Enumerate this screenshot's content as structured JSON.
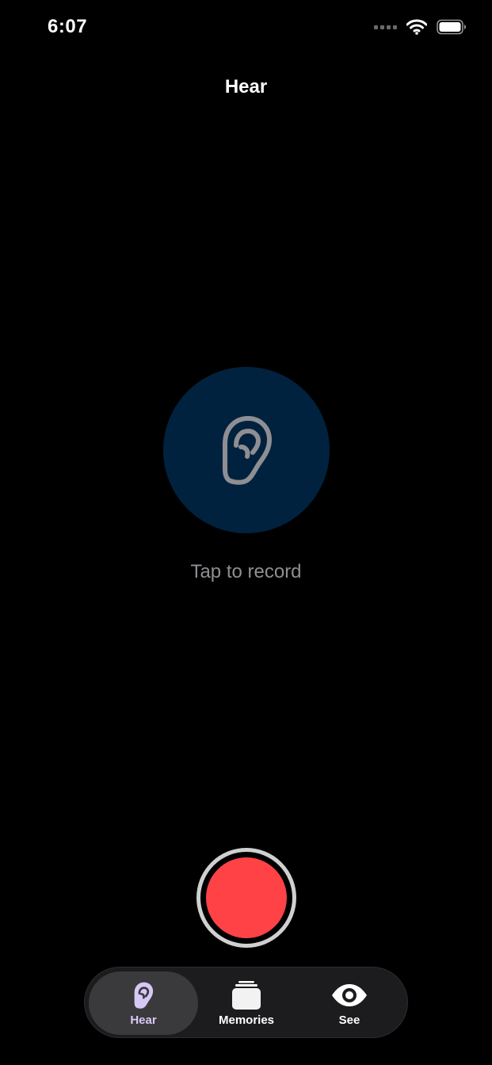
{
  "status_bar": {
    "time": "6:07",
    "signal_icon": "signal-dots-icon",
    "wifi_icon": "wifi-icon",
    "battery_icon": "battery-icon"
  },
  "nav": {
    "title": "Hear"
  },
  "main": {
    "hear_icon": "ear-icon",
    "hint": "Tap to record"
  },
  "record": {
    "icon": "record-dot"
  },
  "tabs": [
    {
      "label": "Hear",
      "icon": "ear-icon",
      "active": true
    },
    {
      "label": "Memories",
      "icon": "stack-icon",
      "active": false
    },
    {
      "label": "See",
      "icon": "eye-icon",
      "active": false
    }
  ],
  "colors": {
    "background": "#000000",
    "circle": "#00223f",
    "ear_stroke": "#8e8e93",
    "hint_text": "#8e8e93",
    "record_red": "#ff4245",
    "active_tab_tint": "#d8c8f6",
    "tab_bar": "#1c1c1e",
    "active_tab_bg": "#3a3a3c"
  }
}
